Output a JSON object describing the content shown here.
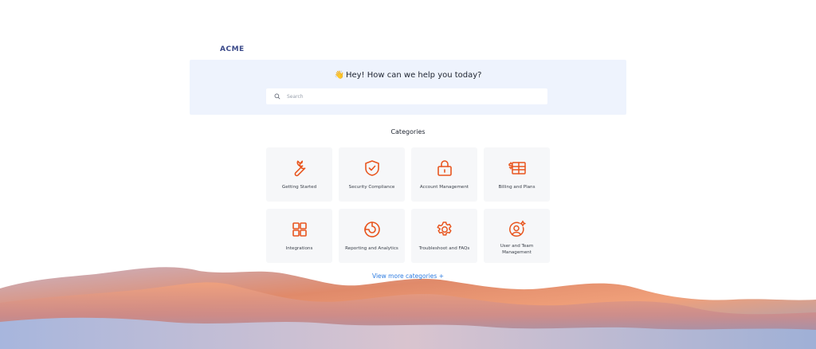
{
  "brand": {
    "logo_text": "ACME"
  },
  "hero": {
    "wave_emoji": "👋",
    "title": "Hey! How can we help you today?",
    "search_placeholder": "Search"
  },
  "categories": {
    "heading": "Categories",
    "items": [
      {
        "label": "Getting Started",
        "icon": "wrench-icon"
      },
      {
        "label": "Security Compliance",
        "icon": "shield-check-icon"
      },
      {
        "label": "Account Management",
        "icon": "lock-icon"
      },
      {
        "label": "Billing and Plans",
        "icon": "billing-icon"
      },
      {
        "label": "Integrations",
        "icon": "grid-icon"
      },
      {
        "label": "Reporting and Analytics",
        "icon": "pie-chart-icon"
      },
      {
        "label": "Troubleshoot and FAQs",
        "icon": "gear-icon"
      },
      {
        "label": "User and Team Management",
        "icon": "user-gear-icon"
      }
    ],
    "view_more": "View more categories +"
  },
  "colors": {
    "accent": "#e8551e",
    "hero_bg": "#eef3fd",
    "card_bg": "#f6f7f9",
    "link": "#2f7de1",
    "logo": "#3b4a8a"
  }
}
